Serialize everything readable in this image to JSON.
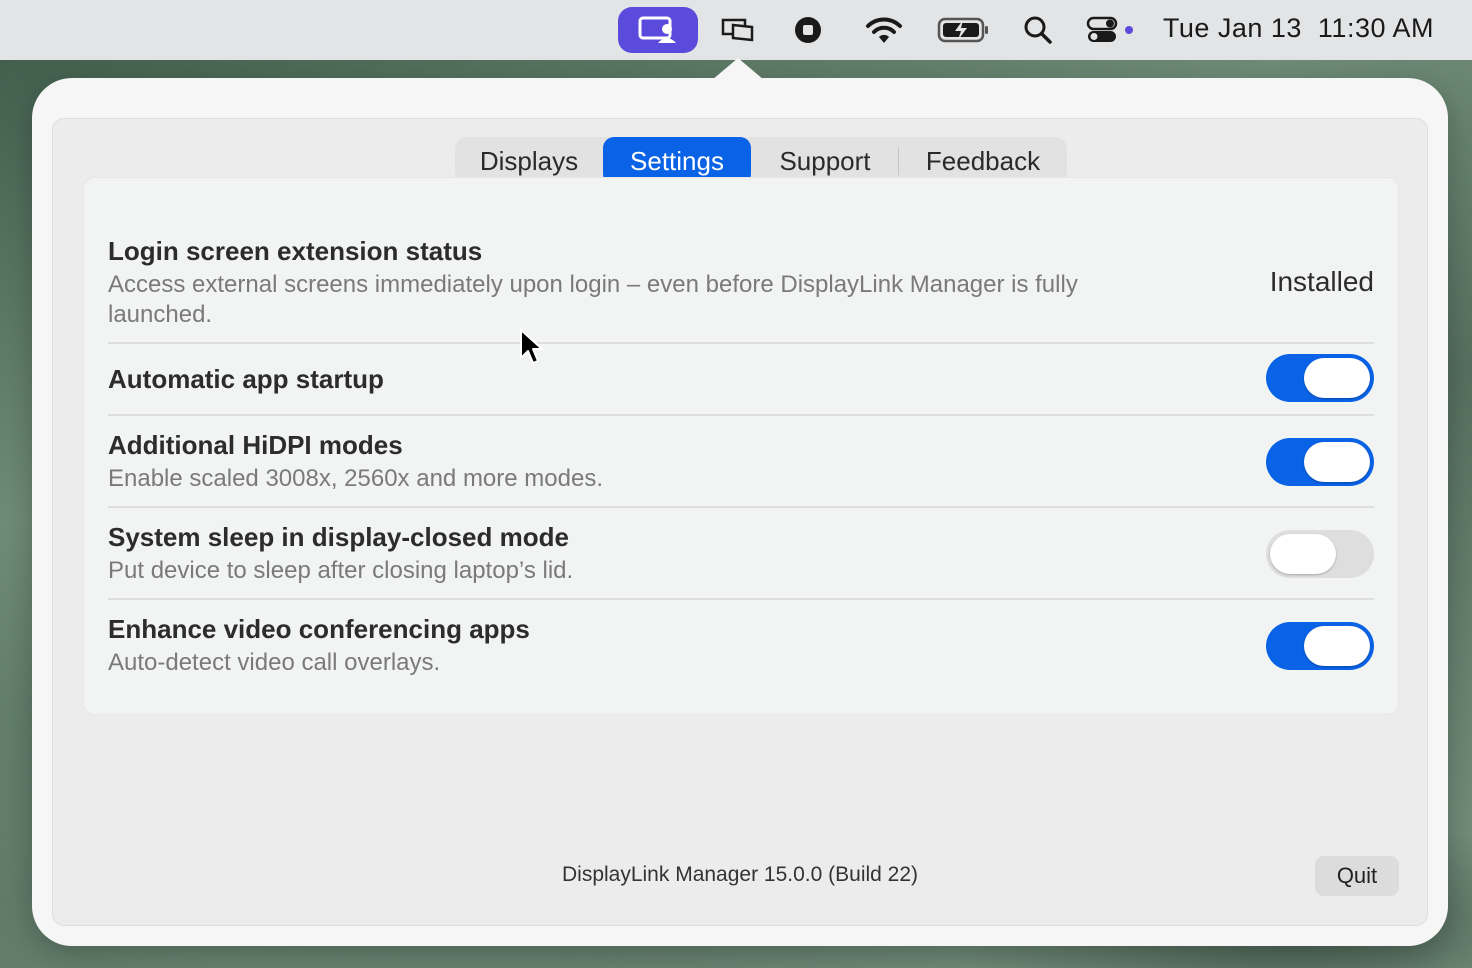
{
  "menubar": {
    "icons": [
      "displaylink-icon",
      "screens-icon",
      "stop-record-icon",
      "wifi-icon",
      "battery-charging-icon",
      "search-icon",
      "control-center-icon"
    ],
    "clock_date": "Tue Jan 13",
    "clock_time": "11:30 AM",
    "accent": "#5a4bdc"
  },
  "tabs": [
    {
      "label": "Displays"
    },
    {
      "label": "Settings",
      "selected": true
    },
    {
      "label": "Support"
    },
    {
      "label": "Feedback"
    }
  ],
  "settings": {
    "login": {
      "title": "Login screen extension status",
      "desc": "Access external screens immediately upon login – even before DisplayLink Manager is fully launched.",
      "status": "Installed"
    },
    "startup": {
      "title": "Automatic app startup",
      "enabled": true
    },
    "hidpi": {
      "title": "Additional HiDPI modes",
      "desc": "Enable scaled 3008x, 2560x and more modes.",
      "enabled": true
    },
    "sleep": {
      "title": "System sleep in display-closed mode",
      "desc": "Put device to sleep after closing laptop’s lid.",
      "enabled": false
    },
    "video": {
      "title": "Enhance video conferencing apps",
      "desc": "Auto-detect video call overlays.",
      "enabled": true
    }
  },
  "footer": {
    "version": "DisplayLink Manager 15.0.0 (Build 22)",
    "quit_label": "Quit"
  },
  "colors": {
    "toggle_on": "#0a63e6",
    "tab_selected": "#0a63e6"
  }
}
